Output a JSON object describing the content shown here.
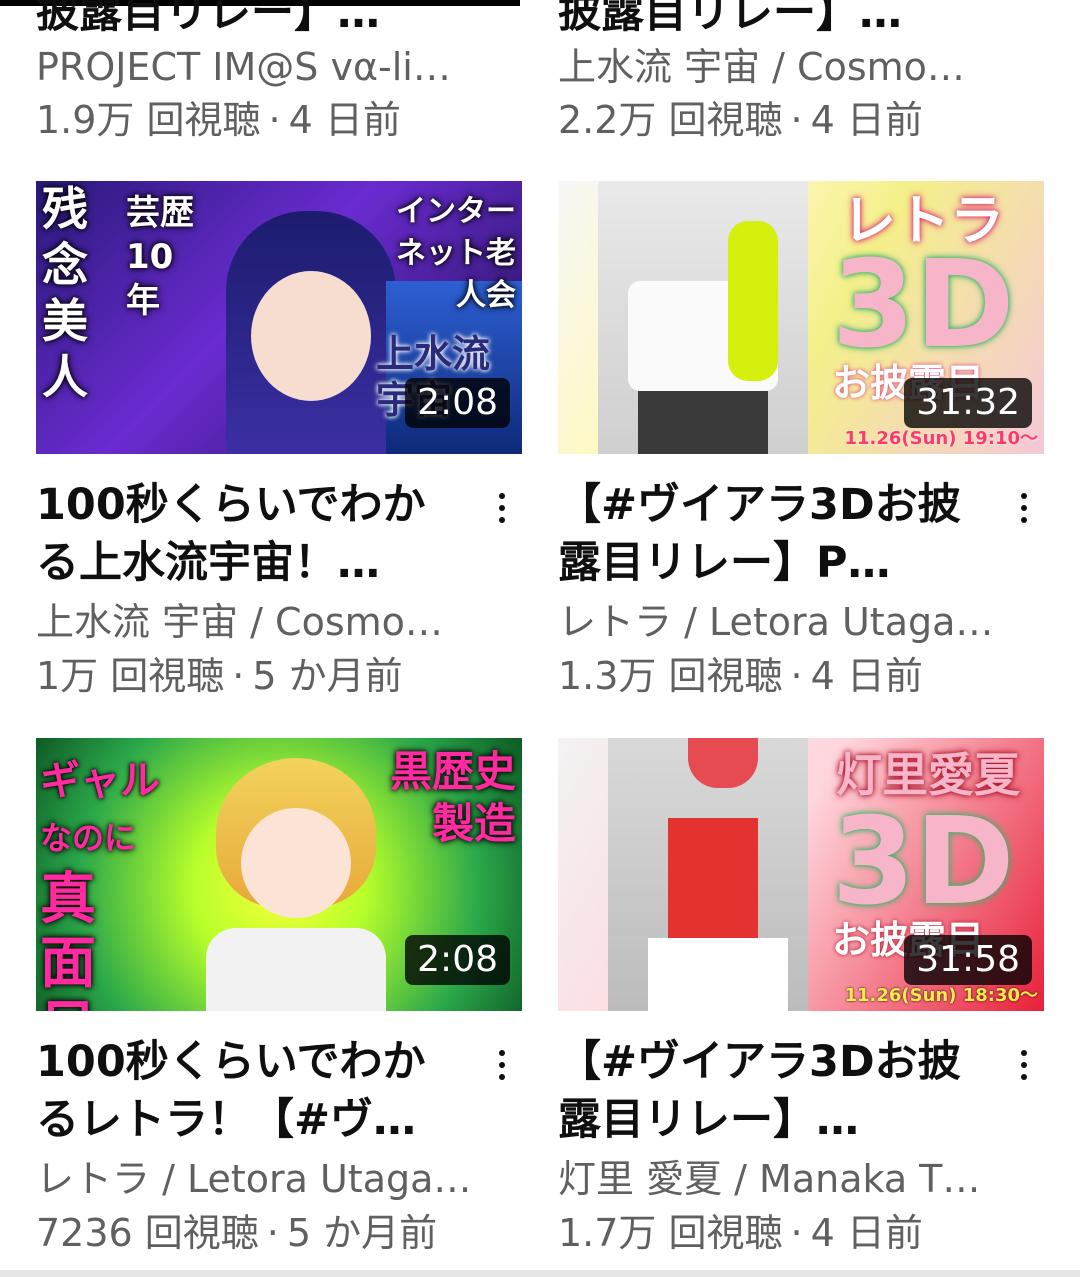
{
  "top_partial": [
    {
      "title_tail": "披露目リレー】…",
      "channel": "PROJECT IM@S vα-li…",
      "views": "1.9万 回視聴",
      "age": "4 日前"
    },
    {
      "title_tail": "披露目リレー】…",
      "channel": "上水流 宇宙 / Cosmo…",
      "views": "2.2万 回視聴",
      "age": "4 日前"
    }
  ],
  "videos": [
    {
      "title": "100秒くらいでわかる上水流宇宙！…",
      "channel": "上水流 宇宙 / Cosmo…",
      "views": "1万 回視聴",
      "age": "5 か月前",
      "duration": "2:08",
      "thumb_text": {
        "a": "残念美人",
        "b": "芸歴10年",
        "c": "インターネット老人会",
        "d": "上水流宇宙"
      }
    },
    {
      "title": "【#ヴイアラ3Dお披露目リレー】P…",
      "channel": "レトラ / Letora Utaga…",
      "views": "1.3万 回視聴",
      "age": "4 日前",
      "duration": "31:32",
      "thumb_text": {
        "a": "レトラ",
        "b": "3D",
        "c": "お披露目",
        "d": "11.26(Sun) 19:10〜"
      }
    },
    {
      "title": "100秒くらいでわかるレトラ！【#ヴ…",
      "channel": "レトラ / Letora Utaga…",
      "views": "7236 回視聴",
      "age": "5 か月前",
      "duration": "2:08",
      "thumb_text": {
        "a": "ギャル",
        "b": "なのに",
        "c": "真面目",
        "d": "黒歴史製造"
      }
    },
    {
      "title": "【#ヴイアラ3Dお披露目リレー】…",
      "channel": "灯里 愛夏 / Manaka T…",
      "views": "1.7万 回視聴",
      "age": "4 日前",
      "duration": "31:58",
      "thumb_text": {
        "a": "灯里愛夏",
        "b": "3D",
        "c": "お披露目",
        "d": "11.26(Sun) 18:30〜"
      }
    }
  ],
  "colors": {
    "text_primary": "#0f0f0f",
    "text_secondary": "#606060"
  }
}
